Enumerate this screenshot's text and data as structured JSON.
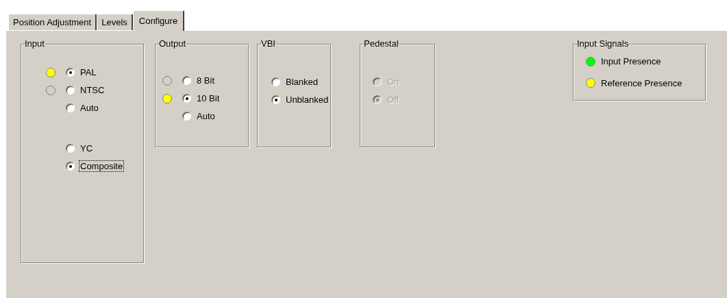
{
  "tabs": [
    {
      "label": "Position Adjustment",
      "selected": false
    },
    {
      "label": "Levels",
      "selected": false
    },
    {
      "label": "Configure",
      "selected": true
    }
  ],
  "groups": [
    {
      "kind": "radios",
      "title": "Input",
      "disabled": false,
      "radio_sets": [
        [
          {
            "label": "PAL",
            "selected": true,
            "focused": false,
            "indicator": {
              "lit": true,
              "color": "#ffff00"
            }
          },
          {
            "label": "NTSC",
            "selected": false,
            "focused": false,
            "indicator": {
              "lit": false
            }
          },
          {
            "label": "Auto",
            "selected": false,
            "focused": false
          }
        ],
        [
          {
            "label": "YC",
            "selected": false,
            "focused": false
          },
          {
            "label": "Composite",
            "selected": true,
            "focused": true
          }
        ]
      ]
    },
    {
      "kind": "radios",
      "title": "Output",
      "disabled": false,
      "radio_sets": [
        [
          {
            "label": "8 Bit",
            "selected": false,
            "focused": false,
            "indicator": {
              "lit": false
            }
          },
          {
            "label": "10 Bit",
            "selected": true,
            "focused": false,
            "indicator": {
              "lit": true,
              "color": "#ffff00"
            }
          },
          {
            "label": "Auto",
            "selected": false,
            "focused": false
          }
        ]
      ]
    },
    {
      "kind": "radios",
      "title": "VBI",
      "disabled": false,
      "radio_sets": [
        [
          {
            "label": "Blanked",
            "selected": false,
            "focused": false
          },
          {
            "label": "Unblanked",
            "selected": true,
            "focused": false
          }
        ]
      ]
    },
    {
      "kind": "radios",
      "title": "Pedestal",
      "disabled": true,
      "radio_sets": [
        [
          {
            "label": "On",
            "selected": false,
            "focused": false
          },
          {
            "label": "Off",
            "selected": true,
            "focused": false
          }
        ]
      ]
    },
    {
      "kind": "signals",
      "title": "Input Signals",
      "signals": [
        {
          "label": "Input Presence",
          "color": "#00ff00"
        },
        {
          "label": "Reference Presence",
          "color": "#ffff00"
        }
      ]
    }
  ]
}
